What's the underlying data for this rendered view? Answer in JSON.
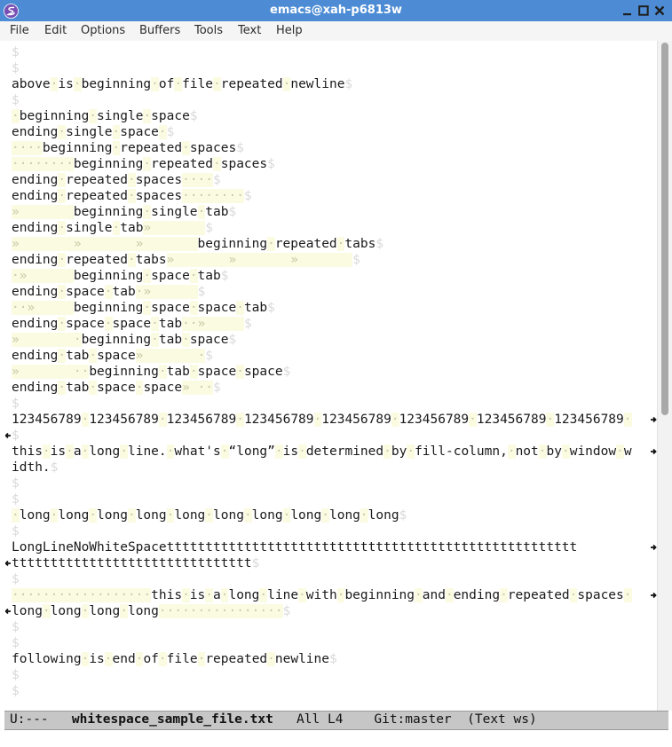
{
  "window": {
    "title": "emacs@xah-p6813w",
    "icon": "emacs-logo-icon",
    "controls": [
      "minimize-icon",
      "maximize-icon",
      "close-icon"
    ]
  },
  "menubar": {
    "items": [
      "File",
      "Edit",
      "Options",
      "Buffers",
      "Tools",
      "Text",
      "Help"
    ]
  },
  "whitespace_glyphs": {
    "space": "·",
    "tab": "»",
    "newline": "$",
    "wrap_left": "continuation-arrow-icon",
    "wrap_right": "wrap-arrow-icon"
  },
  "buffer": {
    "lines": [
      {
        "segs": [
          [
            "e",
            "$"
          ]
        ]
      },
      {
        "segs": [
          [
            "e",
            "$"
          ]
        ]
      },
      {
        "segs": [
          [
            "t",
            "above"
          ],
          [
            "w",
            "·"
          ],
          [
            "t",
            "is"
          ],
          [
            "w",
            "·"
          ],
          [
            "t",
            "beginning"
          ],
          [
            "w",
            "·"
          ],
          [
            "t",
            "of"
          ],
          [
            "w",
            "·"
          ],
          [
            "t",
            "file"
          ],
          [
            "w",
            "·"
          ],
          [
            "t",
            "repeated"
          ],
          [
            "w",
            "·"
          ],
          [
            "t",
            "newline"
          ],
          [
            "e",
            "$"
          ]
        ]
      },
      {
        "segs": [
          [
            "e",
            "$"
          ]
        ]
      },
      {
        "segs": [
          [
            "w",
            "·"
          ],
          [
            "t",
            "beginning"
          ],
          [
            "w",
            "·"
          ],
          [
            "t",
            "single"
          ],
          [
            "w",
            "·"
          ],
          [
            "t",
            "space"
          ],
          [
            "e",
            "$"
          ]
        ]
      },
      {
        "segs": [
          [
            "t",
            "ending"
          ],
          [
            "w",
            "·"
          ],
          [
            "t",
            "single"
          ],
          [
            "w",
            "·"
          ],
          [
            "t",
            "space"
          ],
          [
            "w",
            "·"
          ],
          [
            "e",
            "$"
          ]
        ]
      },
      {
        "segs": [
          [
            "w",
            "····"
          ],
          [
            "t",
            "beginning"
          ],
          [
            "w",
            "·"
          ],
          [
            "t",
            "repeated"
          ],
          [
            "w",
            "·"
          ],
          [
            "t",
            "spaces"
          ],
          [
            "e",
            "$"
          ]
        ]
      },
      {
        "segs": [
          [
            "w",
            "········"
          ],
          [
            "t",
            "beginning"
          ],
          [
            "w",
            "·"
          ],
          [
            "t",
            "repeated"
          ],
          [
            "w",
            "·"
          ],
          [
            "t",
            "spaces"
          ],
          [
            "e",
            "$"
          ]
        ]
      },
      {
        "segs": [
          [
            "t",
            "ending"
          ],
          [
            "w",
            "·"
          ],
          [
            "t",
            "repeated"
          ],
          [
            "w",
            "·"
          ],
          [
            "t",
            "spaces"
          ],
          [
            "w",
            "····"
          ],
          [
            "e",
            "$"
          ]
        ]
      },
      {
        "segs": [
          [
            "t",
            "ending"
          ],
          [
            "w",
            "·"
          ],
          [
            "t",
            "repeated"
          ],
          [
            "w",
            "·"
          ],
          [
            "t",
            "spaces"
          ],
          [
            "w",
            "········"
          ],
          [
            "e",
            "$"
          ]
        ]
      },
      {
        "segs": [
          [
            "w",
            "»       "
          ],
          [
            "t",
            "beginning"
          ],
          [
            "w",
            "·"
          ],
          [
            "t",
            "single"
          ],
          [
            "w",
            "·"
          ],
          [
            "t",
            "tab"
          ],
          [
            "e",
            "$"
          ]
        ]
      },
      {
        "segs": [
          [
            "t",
            "ending"
          ],
          [
            "w",
            "·"
          ],
          [
            "t",
            "single"
          ],
          [
            "w",
            "·"
          ],
          [
            "t",
            "tab"
          ],
          [
            "w",
            "»       "
          ],
          [
            "e",
            "$"
          ]
        ]
      },
      {
        "segs": [
          [
            "w",
            "»       »       »       "
          ],
          [
            "t",
            "beginning"
          ],
          [
            "w",
            "·"
          ],
          [
            "t",
            "repeated"
          ],
          [
            "w",
            "·"
          ],
          [
            "t",
            "tabs"
          ],
          [
            "e",
            "$"
          ]
        ]
      },
      {
        "segs": [
          [
            "t",
            "ending"
          ],
          [
            "w",
            "·"
          ],
          [
            "t",
            "repeated"
          ],
          [
            "w",
            "·"
          ],
          [
            "t",
            "tabs"
          ],
          [
            "w",
            "»       »       »       "
          ],
          [
            "e",
            "$"
          ]
        ]
      },
      {
        "segs": [
          [
            "w",
            "·»      "
          ],
          [
            "t",
            "beginning"
          ],
          [
            "w",
            "·"
          ],
          [
            "t",
            "space"
          ],
          [
            "w",
            "·"
          ],
          [
            "t",
            "tab"
          ],
          [
            "e",
            "$"
          ]
        ]
      },
      {
        "segs": [
          [
            "t",
            "ending"
          ],
          [
            "w",
            "·"
          ],
          [
            "t",
            "space"
          ],
          [
            "w",
            "·"
          ],
          [
            "t",
            "tab"
          ],
          [
            "w",
            "·»      "
          ],
          [
            "e",
            "$"
          ]
        ]
      },
      {
        "segs": [
          [
            "w",
            "··»     "
          ],
          [
            "t",
            "beginning"
          ],
          [
            "w",
            "·"
          ],
          [
            "t",
            "space"
          ],
          [
            "w",
            "·"
          ],
          [
            "t",
            "space"
          ],
          [
            "w",
            "·"
          ],
          [
            "t",
            "tab"
          ],
          [
            "e",
            "$"
          ]
        ]
      },
      {
        "segs": [
          [
            "t",
            "ending"
          ],
          [
            "w",
            "·"
          ],
          [
            "t",
            "space"
          ],
          [
            "w",
            "·"
          ],
          [
            "t",
            "space"
          ],
          [
            "w",
            "·"
          ],
          [
            "t",
            "tab"
          ],
          [
            "w",
            "··»     "
          ],
          [
            "e",
            "$"
          ]
        ]
      },
      {
        "segs": [
          [
            "w",
            "»       ·"
          ],
          [
            "t",
            "beginning"
          ],
          [
            "w",
            "·"
          ],
          [
            "t",
            "tab"
          ],
          [
            "w",
            "·"
          ],
          [
            "t",
            "space"
          ],
          [
            "e",
            "$"
          ]
        ]
      },
      {
        "segs": [
          [
            "t",
            "ending"
          ],
          [
            "w",
            "·"
          ],
          [
            "t",
            "tab"
          ],
          [
            "w",
            "·"
          ],
          [
            "t",
            "space"
          ],
          [
            "w",
            "»       ·"
          ],
          [
            "e",
            "$"
          ]
        ]
      },
      {
        "segs": [
          [
            "w",
            "»       ··"
          ],
          [
            "t",
            "beginning"
          ],
          [
            "w",
            "·"
          ],
          [
            "t",
            "tab"
          ],
          [
            "w",
            "·"
          ],
          [
            "t",
            "space"
          ],
          [
            "w",
            "·"
          ],
          [
            "t",
            "space"
          ],
          [
            "e",
            "$"
          ]
        ]
      },
      {
        "segs": [
          [
            "t",
            "ending"
          ],
          [
            "w",
            "·"
          ],
          [
            "t",
            "tab"
          ],
          [
            "w",
            "·"
          ],
          [
            "t",
            "space"
          ],
          [
            "w",
            "·"
          ],
          [
            "t",
            "space"
          ],
          [
            "w",
            "» ··"
          ],
          [
            "e",
            "$"
          ]
        ]
      },
      {
        "segs": [
          [
            "e",
            "$"
          ]
        ]
      },
      {
        "segs": [
          [
            "t",
            "123456789"
          ],
          [
            "w",
            "·"
          ],
          [
            "t",
            "123456789"
          ],
          [
            "w",
            "·"
          ],
          [
            "t",
            "123456789"
          ],
          [
            "w",
            "·"
          ],
          [
            "t",
            "123456789"
          ],
          [
            "w",
            "·"
          ],
          [
            "t",
            "123456789"
          ],
          [
            "w",
            "·"
          ],
          [
            "t",
            "123456789"
          ],
          [
            "w",
            "·"
          ],
          [
            "t",
            "123456789"
          ],
          [
            "w",
            "·"
          ],
          [
            "t",
            "123456789"
          ],
          [
            "w",
            "·"
          ]
        ],
        "wrap_right": true
      },
      {
        "segs": [
          [
            "e",
            "$"
          ]
        ],
        "wrap_left": true
      },
      {
        "segs": [
          [
            "t",
            "this"
          ],
          [
            "w",
            "·"
          ],
          [
            "t",
            "is"
          ],
          [
            "w",
            "·"
          ],
          [
            "t",
            "a"
          ],
          [
            "w",
            "·"
          ],
          [
            "t",
            "long"
          ],
          [
            "w",
            "·"
          ],
          [
            "t",
            "line."
          ],
          [
            "w",
            "·"
          ],
          [
            "t",
            "what's"
          ],
          [
            "w",
            "·"
          ],
          [
            "t",
            "“long”"
          ],
          [
            "w",
            "·"
          ],
          [
            "t",
            "is"
          ],
          [
            "w",
            "·"
          ],
          [
            "t",
            "determined"
          ],
          [
            "w",
            "·"
          ],
          [
            "t",
            "by"
          ],
          [
            "w",
            "·"
          ],
          [
            "t",
            "fill-column,"
          ],
          [
            "w",
            "·"
          ],
          [
            "t",
            "not"
          ],
          [
            "w",
            "·"
          ],
          [
            "t",
            "by"
          ],
          [
            "w",
            "·"
          ],
          [
            "t",
            "window"
          ],
          [
            "w",
            "·"
          ],
          [
            "t",
            "w"
          ]
        ],
        "wrap_right": true
      },
      {
        "segs": [
          [
            "t",
            "idth."
          ],
          [
            "e",
            "$"
          ]
        ]
      },
      {
        "segs": [
          [
            "e",
            "$"
          ]
        ]
      },
      {
        "segs": [
          [
            "e",
            "$"
          ]
        ]
      },
      {
        "segs": [
          [
            "w",
            "·"
          ],
          [
            "t",
            "long"
          ],
          [
            "w",
            "·"
          ],
          [
            "t",
            "long"
          ],
          [
            "w",
            "·"
          ],
          [
            "t",
            "long"
          ],
          [
            "w",
            "·"
          ],
          [
            "t",
            "long"
          ],
          [
            "w",
            "·"
          ],
          [
            "t",
            "long"
          ],
          [
            "w",
            "·"
          ],
          [
            "t",
            "long"
          ],
          [
            "w",
            "·"
          ],
          [
            "t",
            "long"
          ],
          [
            "w",
            "·"
          ],
          [
            "t",
            "long"
          ],
          [
            "w",
            "·"
          ],
          [
            "t",
            "long"
          ],
          [
            "w",
            "·"
          ],
          [
            "t",
            "long"
          ],
          [
            "e",
            "$"
          ]
        ]
      },
      {
        "segs": [
          [
            "e",
            "$"
          ]
        ]
      },
      {
        "segs": [
          [
            "t",
            "LongLineNoWhiteSpacettttttttttttttttttttttttttttttttttttttttttttttttttttt"
          ]
        ],
        "wrap_right": true
      },
      {
        "segs": [
          [
            "t",
            "ttttttttttttttttttttttttttttttt"
          ],
          [
            "e",
            "$"
          ]
        ],
        "wrap_left": true
      },
      {
        "segs": [
          [
            "e",
            "$"
          ]
        ]
      },
      {
        "segs": [
          [
            "w",
            "··················"
          ],
          [
            "t",
            "this"
          ],
          [
            "w",
            "·"
          ],
          [
            "t",
            "is"
          ],
          [
            "w",
            "·"
          ],
          [
            "t",
            "a"
          ],
          [
            "w",
            "·"
          ],
          [
            "t",
            "long"
          ],
          [
            "w",
            "·"
          ],
          [
            "t",
            "line"
          ],
          [
            "w",
            "·"
          ],
          [
            "t",
            "with"
          ],
          [
            "w",
            "·"
          ],
          [
            "t",
            "beginning"
          ],
          [
            "w",
            "·"
          ],
          [
            "t",
            "and"
          ],
          [
            "w",
            "·"
          ],
          [
            "t",
            "ending"
          ],
          [
            "w",
            "·"
          ],
          [
            "t",
            "repeated"
          ],
          [
            "w",
            "·"
          ],
          [
            "t",
            "spaces"
          ],
          [
            "w",
            "·"
          ]
        ],
        "wrap_right": true
      },
      {
        "segs": [
          [
            "t",
            "long"
          ],
          [
            "w",
            "·"
          ],
          [
            "t",
            "long"
          ],
          [
            "w",
            "·"
          ],
          [
            "t",
            "long"
          ],
          [
            "w",
            "·"
          ],
          [
            "t",
            "long"
          ],
          [
            "w",
            "················"
          ],
          [
            "e",
            "$"
          ]
        ],
        "wrap_left": true
      },
      {
        "segs": [
          [
            "e",
            "$"
          ]
        ]
      },
      {
        "segs": [
          [
            "e",
            "$"
          ]
        ]
      },
      {
        "segs": [
          [
            "t",
            "following"
          ],
          [
            "w",
            "·"
          ],
          [
            "t",
            "is"
          ],
          [
            "w",
            "·"
          ],
          [
            "t",
            "end"
          ],
          [
            "w",
            "·"
          ],
          [
            "t",
            "of"
          ],
          [
            "w",
            "·"
          ],
          [
            "t",
            "file"
          ],
          [
            "w",
            "·"
          ],
          [
            "t",
            "repeated"
          ],
          [
            "w",
            "·"
          ],
          [
            "t",
            "newline"
          ],
          [
            "e",
            "$"
          ]
        ]
      },
      {
        "segs": [
          [
            "e",
            "$"
          ]
        ]
      },
      {
        "segs": [
          [
            "e",
            "$"
          ]
        ]
      }
    ]
  },
  "modeline": {
    "status": "U:---",
    "buffer_name": "whitespace_sample_file.txt",
    "position": "All L4",
    "vc": "Git:master",
    "modes": "(Text ws)"
  }
}
